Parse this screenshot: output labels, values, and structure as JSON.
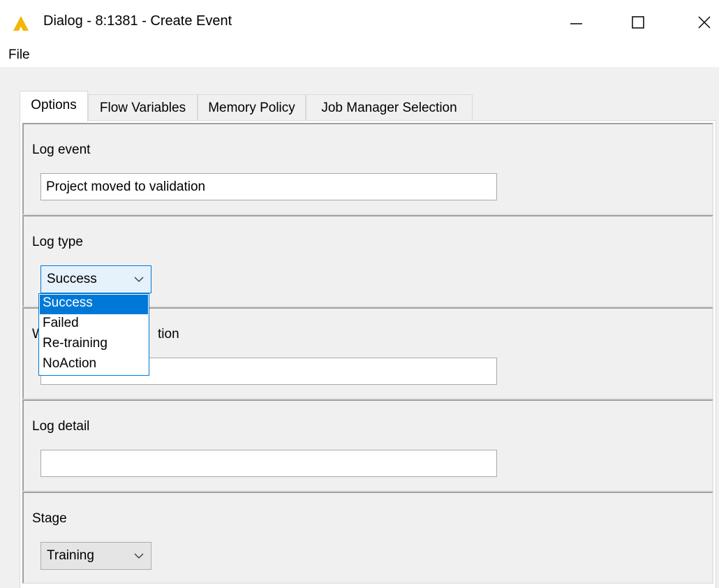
{
  "window": {
    "title": "Dialog - 8:1381 - Create Event",
    "icon": "warning-triangle-icon",
    "accent_color": "#0078d7",
    "icon_color": "#f2b705"
  },
  "menubar": {
    "file_label": "File"
  },
  "tabs": [
    {
      "label": "Options",
      "active": true
    },
    {
      "label": "Flow Variables",
      "active": false
    },
    {
      "label": "Memory Policy",
      "active": false
    },
    {
      "label": "Job Manager Selection",
      "active": false
    }
  ],
  "options": {
    "log_event": {
      "label": "Log event",
      "value": "Project moved to validation"
    },
    "log_type": {
      "label": "Log type",
      "selected": "Success",
      "options": [
        "Success",
        "Failed",
        "Re-training",
        "NoAction"
      ]
    },
    "workflow_location": {
      "label_visible_prefix": "W",
      "label_visible_suffix": "tion",
      "value": ""
    },
    "log_detail": {
      "label": "Log detail",
      "value": ""
    },
    "stage": {
      "label": "Stage",
      "selected": "Training"
    }
  }
}
